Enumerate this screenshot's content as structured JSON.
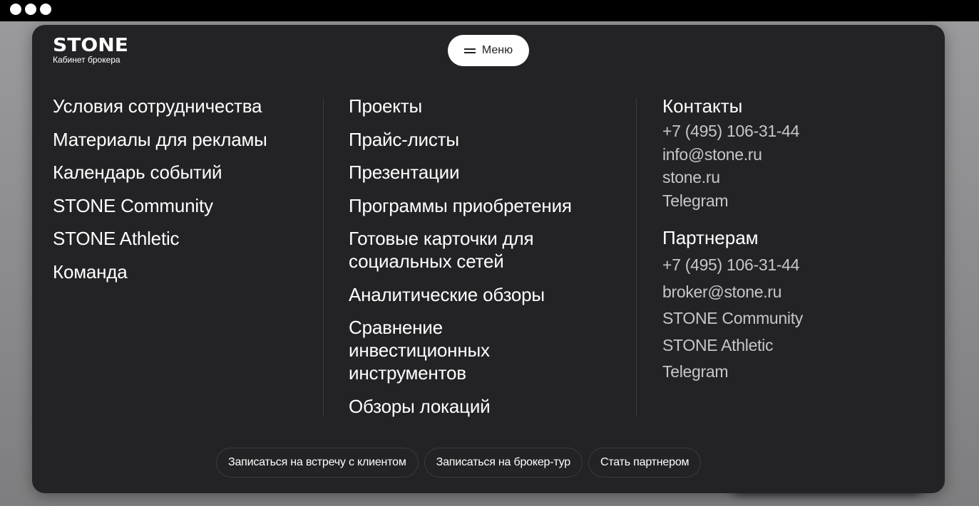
{
  "window": {
    "dots": [
      "close",
      "minimize",
      "maximize"
    ]
  },
  "header": {
    "logo_word": "STONE",
    "logo_sub": "Кабинет брокера",
    "menu_label": "Меню",
    "menu_icon": "burger-icon"
  },
  "col1": {
    "items": [
      "Условия сотрудничества",
      "Материалы для рекламы",
      "Календарь событий",
      "STONE Community",
      "STONE Athletic",
      "Команда"
    ]
  },
  "col2": {
    "items": [
      "Проекты",
      "Прайс-листы",
      "Презентации",
      "Программы приобретения",
      "Готовые карточки для социальных сетей",
      "Аналитические обзоры",
      "Сравнение инвестиционных инструментов",
      "Обзоры локаций"
    ]
  },
  "contacts": {
    "title": "Контакты",
    "phone": "+7 (495) 106-31-44",
    "email": "info@stone.ru",
    "site": "stone.ru",
    "telegram": "Telegram"
  },
  "partners": {
    "title": "Партнерам",
    "phone": "+7 (495) 106-31-44",
    "email": "broker@stone.ru",
    "community": "STONE Community",
    "athletic": "STONE Athletic",
    "telegram": "Telegram"
  },
  "actions": {
    "meeting": "Записаться на встречу с клиентом",
    "tour": "Записаться на брокер-тур",
    "partner": "Стать партнером"
  },
  "colors": {
    "panel": "#232326",
    "accent": "#ffffff",
    "muted_text": "#c6c6c8"
  }
}
